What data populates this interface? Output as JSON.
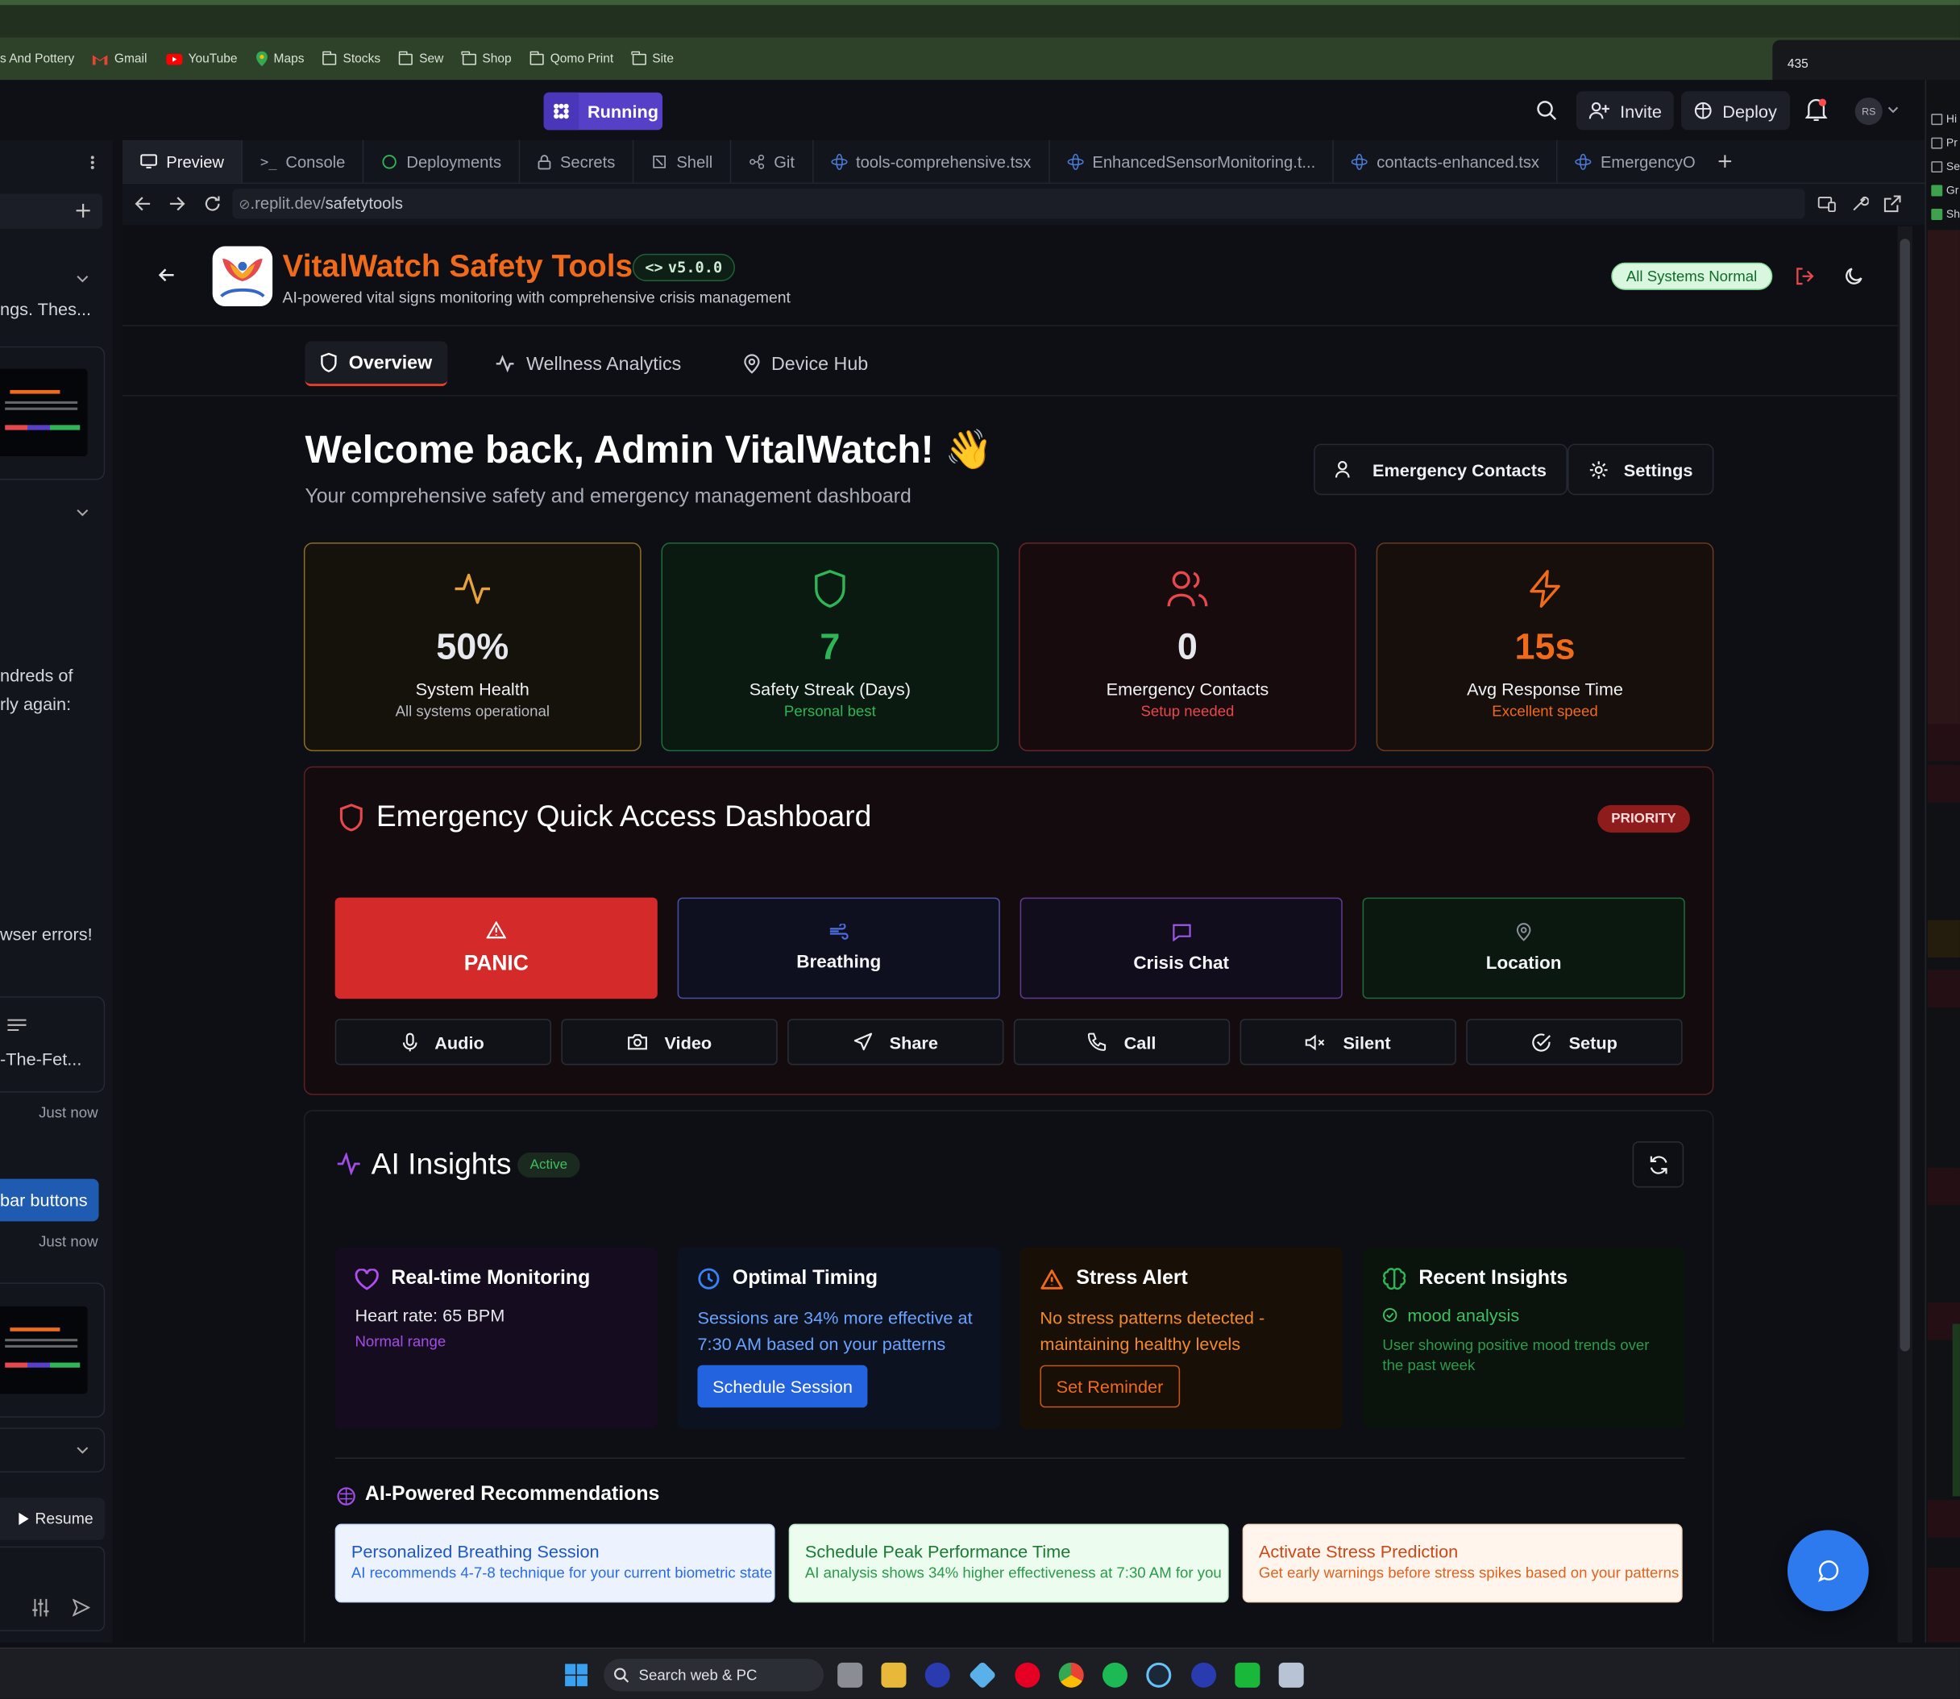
{
  "browser": {
    "bookmarks": [
      {
        "label": "s And Pottery",
        "icon": "none"
      },
      {
        "label": "Gmail",
        "icon": "gmail-icon"
      },
      {
        "label": "YouTube",
        "icon": "youtube-icon"
      },
      {
        "label": "Maps",
        "icon": "maps-icon"
      },
      {
        "label": "Stocks",
        "icon": "folder-icon"
      },
      {
        "label": "Sew",
        "icon": "folder-icon"
      },
      {
        "label": "Shop",
        "icon": "folder-icon"
      },
      {
        "label": "Qomo Print",
        "icon": "folder-icon"
      },
      {
        "label": "Site",
        "icon": "folder-icon"
      }
    ],
    "popup_count": "435"
  },
  "replit": {
    "run_label": "Running",
    "invite_label": "Invite",
    "deploy_label": "Deploy",
    "avatar_initials": "RS",
    "tabs": [
      "Preview",
      "Console",
      "Deployments",
      "Secrets",
      "Shell",
      "Git",
      "tools-comprehensive.tsx",
      "EnhancedSensorMonitoring.t...",
      "contacts-enhanced.tsx",
      "EmergencyO"
    ],
    "url_prefix": ".replit.dev/",
    "url_path": "safetytools"
  },
  "left_panel": {
    "text1": "ngs. Thes...",
    "text2": "ndreds of",
    "text3": "rly again:",
    "text4": "wser errors!",
    "file_label": "-The-Fet...",
    "time1": "Just now",
    "button_label": "bar buttons",
    "time2": "Just now",
    "resume_label": "Resume"
  },
  "app": {
    "title": "VitalWatch Safety Tools",
    "version": "v5.0.0",
    "subtitle": "AI-powered vital signs monitoring with comprehensive crisis management",
    "status": "All Systems Normal",
    "nav": [
      "Overview",
      "Wellness Analytics",
      "Device Hub"
    ],
    "welcome": "Welcome back, Admin VitalWatch!",
    "welcome_emoji": "👋",
    "welcome_sub": "Your comprehensive safety and emergency management dashboard",
    "emergency_contacts_btn": "Emergency Contacts",
    "settings_btn": "Settings",
    "stats": [
      {
        "value": "50%",
        "label": "System Health",
        "sub": "All systems operational",
        "color": "#e6a23c"
      },
      {
        "value": "7",
        "label": "Safety Streak (Days)",
        "sub": "Personal best",
        "color": "#2fb557"
      },
      {
        "value": "0",
        "label": "Emergency Contacts",
        "sub": "Setup needed",
        "color": "#e5484d"
      },
      {
        "value": "15s",
        "label": "Avg Response Time",
        "sub": "Excellent speed",
        "color": "#f06a1b"
      }
    ],
    "emergency": {
      "title": "Emergency Quick Access Dashboard",
      "priority": "PRIORITY",
      "big_buttons": [
        "PANIC",
        "Breathing",
        "Crisis Chat",
        "Location"
      ],
      "small_buttons": [
        "Audio",
        "Video",
        "Share",
        "Call",
        "Silent",
        "Setup"
      ]
    },
    "ai": {
      "title": "AI Insights",
      "badge": "Active",
      "cards": [
        {
          "title": "Real-time Monitoring",
          "line1": "Heart rate: 65 BPM",
          "line2": "Normal range"
        },
        {
          "title": "Optimal Timing",
          "line1": "Sessions are 34% more effective at 7:30 AM based on your patterns",
          "button": "Schedule Session"
        },
        {
          "title": "Stress Alert",
          "line1": "No stress patterns detected - maintaining healthy levels",
          "button": "Set Reminder"
        },
        {
          "title": "Recent Insights",
          "item": "mood analysis",
          "line2": "User showing positive mood trends over the past week"
        }
      ],
      "rec_title": "AI-Powered Recommendations",
      "recs": [
        {
          "title": "Personalized Breathing Session",
          "desc": "AI recommends 4-7-8 technique for your current biometric state"
        },
        {
          "title": "Schedule Peak Performance Time",
          "desc": "AI analysis shows 34% higher effectiveness at 7:30 AM for you"
        },
        {
          "title": "Activate Stress Prediction",
          "desc": "Get early warnings before stress spikes based on your patterns"
        }
      ]
    }
  },
  "devtools": {
    "checkboxes": [
      "Hi",
      "Pr",
      "Se",
      "Gr",
      "Sh"
    ]
  },
  "taskbar": {
    "search_placeholder": "Search web & PC"
  }
}
